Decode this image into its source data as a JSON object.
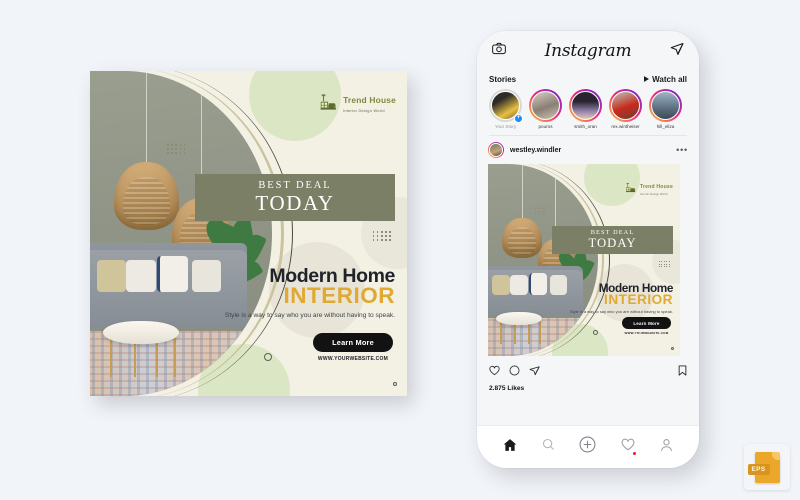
{
  "page": {
    "background_color": "#f1f4f8"
  },
  "poster": {
    "background_color": "#f3f0e4",
    "accent_green": "#7a7f66",
    "accent_gold": "#e0a932",
    "light_green": "#dbe7c4",
    "brand": {
      "logo_icon": "sofa-lamp-logo-icon",
      "name": "Trend House",
      "tagline": "Interior Design World"
    },
    "deal_badge": {
      "line1": "BEST DEAL",
      "line2": "TODAY"
    },
    "headline_line1": "Modern Home",
    "headline_line2": "INTERIOR",
    "subcopy": "Style is a way to say who you are without having to speak.",
    "cta_label": "Learn More",
    "website": "WWW.YOURWEBSITE.COM"
  },
  "phone": {
    "app": {
      "logo": "Instagram",
      "camera_icon": "camera-icon",
      "send_icon": "paper-plane-icon"
    },
    "stories": {
      "title": "Stories",
      "watch_all_label": "Watch all",
      "watch_all_icon": "play-triangle-icon",
      "items": [
        {
          "name": "Your Story",
          "muted": true,
          "has_add": true
        },
        {
          "name": "pouros",
          "muted": false,
          "has_add": false
        },
        {
          "name": "smith_oran",
          "muted": false,
          "has_add": false
        },
        {
          "name": "rex.wintheiser",
          "muted": false,
          "has_add": false
        },
        {
          "name": "hill_eliza",
          "muted": false,
          "has_add": false
        }
      ]
    },
    "post": {
      "username": "westley.windler",
      "more_icon": "ellipsis-icon",
      "actions": {
        "like_icon": "heart-icon",
        "comment_icon": "comment-icon",
        "share_icon": "paper-plane-icon",
        "save_icon": "bookmark-icon"
      },
      "likes": "2.875 Likes"
    },
    "tabbar": {
      "items": [
        {
          "icon": "home-icon",
          "active": true,
          "badge": false
        },
        {
          "icon": "search-icon",
          "active": false,
          "badge": false
        },
        {
          "icon": "plus-circle-icon",
          "active": false,
          "badge": false
        },
        {
          "icon": "heart-icon",
          "active": false,
          "badge": true
        },
        {
          "icon": "person-icon",
          "active": false,
          "badge": false
        }
      ]
    }
  },
  "badge": {
    "format_label": "EPS",
    "color": "#eaa72a"
  }
}
